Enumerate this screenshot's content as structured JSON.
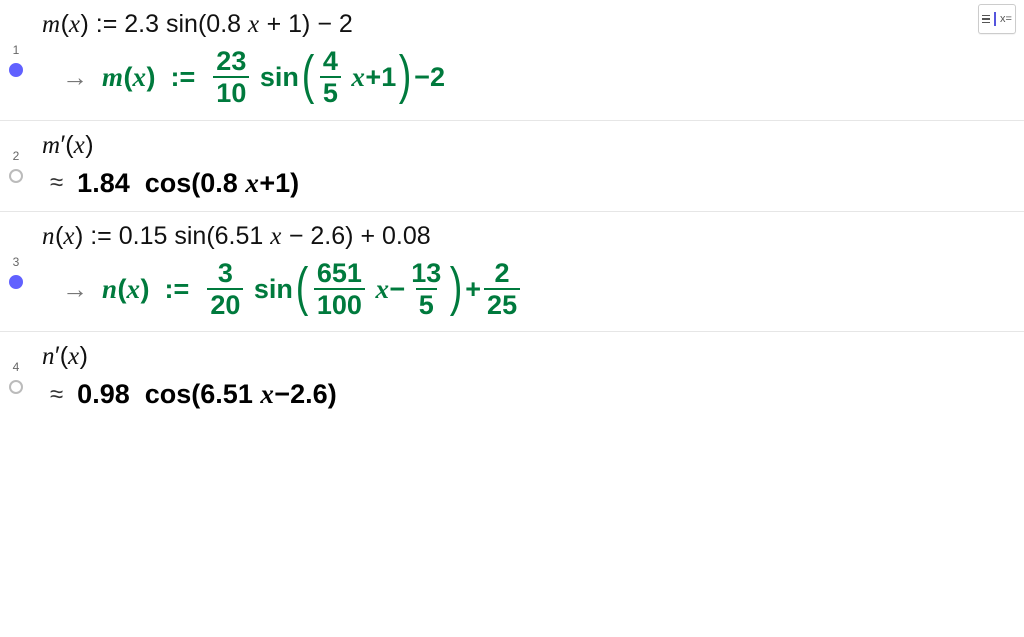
{
  "toolbar": {
    "substitute_label": "x="
  },
  "cells": [
    {
      "index": "1",
      "dot_filled": true,
      "input": {
        "fn": "m",
        "var": "x",
        "assign": ":=",
        "coef": "2.3",
        "trig": "sin",
        "inner_coef": "0.8",
        "inner_var": "x",
        "inner_op": "+",
        "inner_const": "1",
        "outer_op": "−",
        "outer_const": "2"
      },
      "output": {
        "kind": "exact",
        "fn": "m",
        "var": "x",
        "assign": ":=",
        "frac1_num": "23",
        "frac1_den": "10",
        "trig": "sin",
        "frac2_num": "4",
        "frac2_den": "5",
        "inner_var": "x",
        "inner_op": "+",
        "inner_const": "1",
        "outer_op": "−",
        "outer_const": "2"
      }
    },
    {
      "index": "2",
      "dot_filled": false,
      "input": {
        "fn": "m",
        "prime": "′",
        "var": "x"
      },
      "output": {
        "kind": "approx",
        "coef": "1.84",
        "trig": "cos",
        "inner_coef": "0.8",
        "inner_var": "x",
        "inner_op": "+",
        "inner_const": "1"
      }
    },
    {
      "index": "3",
      "dot_filled": true,
      "input": {
        "fn": "n",
        "var": "x",
        "assign": ":=",
        "coef": "0.15",
        "trig": "sin",
        "inner_coef": "6.51",
        "inner_var": "x",
        "inner_op": "−",
        "inner_const": "2.6",
        "outer_op": "+",
        "outer_const": "0.08"
      },
      "output": {
        "kind": "exact",
        "fn": "n",
        "var": "x",
        "assign": ":=",
        "frac1_num": "3",
        "frac1_den": "20",
        "trig": "sin",
        "frac2_num": "651",
        "frac2_den": "100",
        "inner_var": "x",
        "inner_op": "−",
        "frac3_num": "13",
        "frac3_den": "5",
        "outer_op": "+",
        "frac4_num": "2",
        "frac4_den": "25"
      }
    },
    {
      "index": "4",
      "dot_filled": false,
      "input": {
        "fn": "n",
        "prime": "′",
        "var": "x"
      },
      "output": {
        "kind": "approx",
        "coef": "0.98",
        "trig": "cos",
        "inner_coef": "6.51",
        "inner_var": "x",
        "inner_op": "−",
        "inner_const": "2.6"
      }
    }
  ]
}
